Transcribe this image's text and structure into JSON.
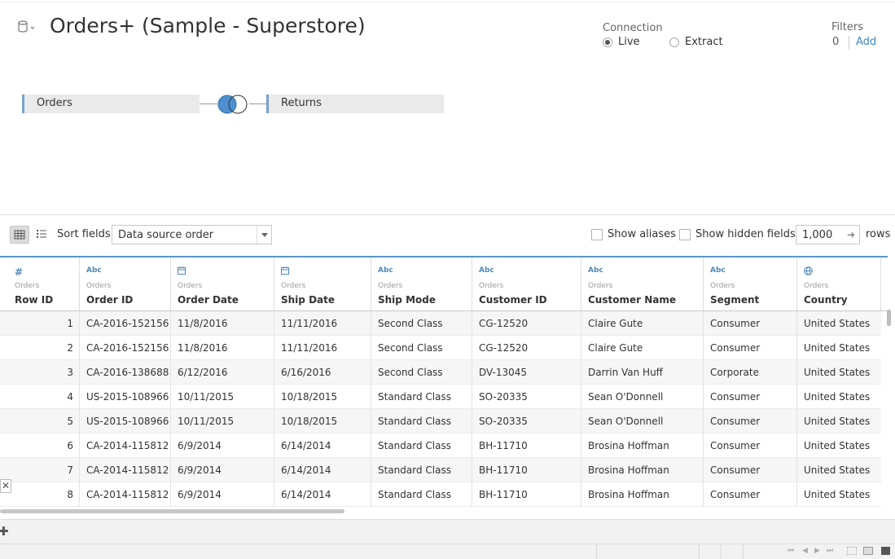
{
  "datasource": {
    "title": "Orders+ (Sample - Superstore)",
    "icon": "database-icon"
  },
  "connection": {
    "label": "Connection",
    "live_label": "Live",
    "extract_label": "Extract",
    "selected": "Live"
  },
  "filters": {
    "label": "Filters",
    "count": "0",
    "add_label": "Add"
  },
  "join": {
    "left_table": "Orders",
    "right_table": "Returns",
    "type": "left-join-icon",
    "accent_color": "#4d8fcf"
  },
  "toolbar": {
    "sort_label": "Sort fields",
    "sort_value": "Data source order",
    "show_aliases_label": "Show aliases",
    "show_hidden_label": "Show hidden fields",
    "rows_value": "1,000",
    "rows_label": "rows"
  },
  "grid": {
    "columns": [
      {
        "type_icon": "#",
        "source": "Orders",
        "name": "Row ID"
      },
      {
        "type_icon": "Abc",
        "source": "Orders",
        "name": "Order ID"
      },
      {
        "type_icon": "calendar-icon",
        "source": "Orders",
        "name": "Order Date"
      },
      {
        "type_icon": "calendar-icon",
        "source": "Orders",
        "name": "Ship Date"
      },
      {
        "type_icon": "Abc",
        "source": "Orders",
        "name": "Ship Mode"
      },
      {
        "type_icon": "Abc",
        "source": "Orders",
        "name": "Customer ID"
      },
      {
        "type_icon": "Abc",
        "source": "Orders",
        "name": "Customer Name"
      },
      {
        "type_icon": "Abc",
        "source": "Orders",
        "name": "Segment"
      },
      {
        "type_icon": "globe-icon",
        "source": "Orders",
        "name": "Country"
      }
    ],
    "rows": [
      [
        "1",
        "CA-2016-152156",
        "11/8/2016",
        "11/11/2016",
        "Second Class",
        "CG-12520",
        "Claire Gute",
        "Consumer",
        "United States"
      ],
      [
        "2",
        "CA-2016-152156",
        "11/8/2016",
        "11/11/2016",
        "Second Class",
        "CG-12520",
        "Claire Gute",
        "Consumer",
        "United States"
      ],
      [
        "3",
        "CA-2016-138688",
        "6/12/2016",
        "6/16/2016",
        "Second Class",
        "DV-13045",
        "Darrin Van Huff",
        "Corporate",
        "United States"
      ],
      [
        "4",
        "US-2015-108966",
        "10/11/2015",
        "10/18/2015",
        "Standard Class",
        "SO-20335",
        "Sean O'Donnell",
        "Consumer",
        "United States"
      ],
      [
        "5",
        "US-2015-108966",
        "10/11/2015",
        "10/18/2015",
        "Standard Class",
        "SO-20335",
        "Sean O'Donnell",
        "Consumer",
        "United States"
      ],
      [
        "6",
        "CA-2014-115812",
        "6/9/2014",
        "6/14/2014",
        "Standard Class",
        "BH-11710",
        "Brosina Hoffman",
        "Consumer",
        "United States"
      ],
      [
        "7",
        "CA-2014-115812",
        "6/9/2014",
        "6/14/2014",
        "Standard Class",
        "BH-11710",
        "Brosina Hoffman",
        "Consumer",
        "United States"
      ],
      [
        "8",
        "CA-2014-115812",
        "6/9/2014",
        "6/14/2014",
        "Standard Class",
        "BH-11710",
        "Brosina Hoffman",
        "Consumer",
        "United States"
      ]
    ]
  }
}
